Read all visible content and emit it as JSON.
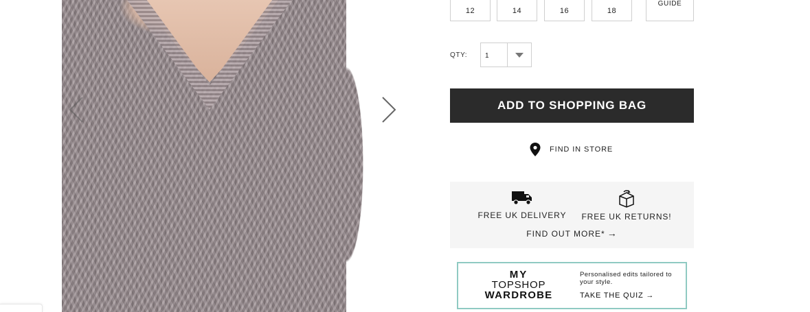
{
  "product_image": {
    "alt": "",
    "prev_icon": "chevron-left-icon",
    "next_icon": "chevron-right-icon"
  },
  "sizes": {
    "options": [
      "12",
      "14",
      "16",
      "18"
    ],
    "guide_label": "GUIDE"
  },
  "quantity": {
    "label": "QTY:",
    "value": "1",
    "caret_icon": "caret-down-icon"
  },
  "add_to_bag": {
    "label": "ADD TO SHOPPING BAG",
    "color": "#2b2b2b"
  },
  "find_in_store": {
    "label": "FIND IN STORE",
    "icon": "map-pin-icon"
  },
  "delivery": {
    "items": [
      {
        "label": "FREE UK DELIVERY",
        "icon": "delivery-truck-icon"
      },
      {
        "label": "FREE UK RETURNS!",
        "icon": "return-box-icon"
      }
    ],
    "find_more_label": "FIND OUT MORE*",
    "find_more_arrow": "→",
    "background": "#f5f5f5"
  },
  "wardrobe_banner": {
    "logo_line1": "MY",
    "logo_line2": "TOPSHOP",
    "logo_line3": "WARDROBE",
    "description": "Personalised edits tailored to your style.",
    "cta_label": "TAKE THE QUIZ",
    "cta_arrow": "→",
    "border_color": "#8fcac2"
  }
}
